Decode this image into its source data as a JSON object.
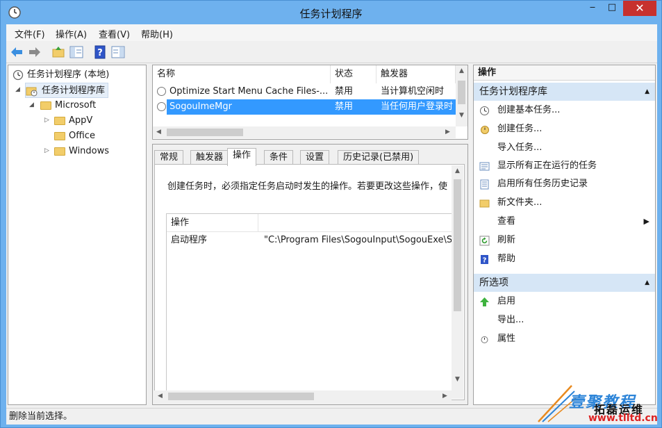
{
  "window": {
    "title": "任务计划程序"
  },
  "titlebar_buttons": {
    "minimize": "‒",
    "maximize": "□",
    "close": "✕"
  },
  "menu": [
    "文件(F)",
    "操作(A)",
    "查看(V)",
    "帮助(H)"
  ],
  "tree": {
    "root": "任务计划程序 (本地)",
    "library": "任务计划程序库",
    "microsoft": "Microsoft",
    "children": [
      "AppV",
      "Office",
      "Windows"
    ]
  },
  "task_list": {
    "columns": [
      "名称",
      "状态",
      "触发器"
    ],
    "rows": [
      {
        "name": "Optimize Start Menu Cache Files-...",
        "status": "禁用",
        "trigger": "当计算机空闲时"
      },
      {
        "name": "SogouImeMgr",
        "status": "禁用",
        "trigger": "当任何用户登录时"
      }
    ],
    "selected_index": 1
  },
  "detail": {
    "tabs": [
      "常规",
      "触发器",
      "操作",
      "条件",
      "设置",
      "历史记录(已禁用)"
    ],
    "active_tab": "操作",
    "description": "创建任务时，必须指定任务启动时发生的操作。若要更改这些操作，使",
    "table_headers": [
      "操作",
      ""
    ],
    "table_rows": [
      {
        "action": "启动程序",
        "detail": "\"C:\\Program Files\\SogouInput\\SogouExe\\S"
      }
    ]
  },
  "actions_panel": {
    "title": "操作",
    "section1": {
      "header": "任务计划程序库",
      "items": [
        {
          "label": "创建基本任务...",
          "icon": "create-basic-task-icon"
        },
        {
          "label": "创建任务...",
          "icon": "create-task-icon"
        },
        {
          "label": "导入任务...",
          "icon": ""
        },
        {
          "label": "显示所有正在运行的任务",
          "icon": "running-tasks-icon"
        },
        {
          "label": "启用所有任务历史记录",
          "icon": "history-icon"
        },
        {
          "label": "新文件夹...",
          "icon": "folder-icon"
        },
        {
          "label": "查看",
          "icon": ""
        },
        {
          "label": "刷新",
          "icon": "refresh-icon"
        },
        {
          "label": "帮助",
          "icon": "help-icon"
        }
      ]
    },
    "section2": {
      "header": "所选项",
      "items": [
        {
          "label": "启用",
          "icon": "enable-icon"
        },
        {
          "label": "导出...",
          "icon": ""
        },
        {
          "label": "属性",
          "icon": "properties-icon"
        }
      ]
    }
  },
  "status_bar": {
    "text": "删除当前选择。"
  },
  "watermark": {
    "line1": "壹聚教程",
    "line2": "拓磊运维",
    "line3": "www.tlltd.cn"
  },
  "colors": {
    "title_bg": "#6eb1ee",
    "selection": "#3399ff",
    "section_bg": "#d6e6f6",
    "close_btn": "#c7312e"
  }
}
